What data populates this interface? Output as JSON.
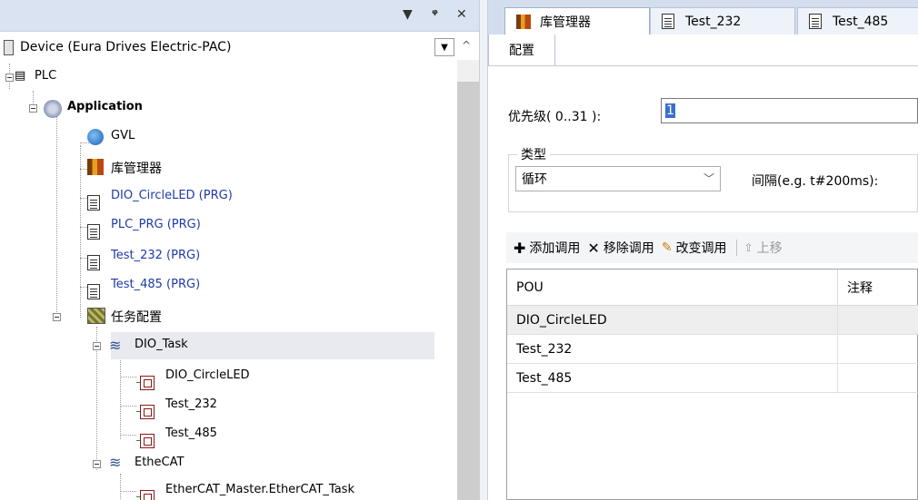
{
  "left_pane": {
    "header_buttons": [
      "▼",
      "ᵠ",
      "✕"
    ],
    "device_title": "Device (Eura Drives Electric-PAC)",
    "tree": [
      {
        "label": "PLC",
        "level": 0,
        "style": "normal"
      },
      {
        "label": "Application",
        "level": 1,
        "style": "bold"
      },
      {
        "label": "GVL",
        "level": 2,
        "style": "normal"
      },
      {
        "label": "库管理器",
        "level": 2,
        "style": "normal"
      },
      {
        "label": "DIO_CircleLED (PRG)",
        "level": 2,
        "style": "blue"
      },
      {
        "label": "PLC_PRG (PRG)",
        "level": 2,
        "style": "blue"
      },
      {
        "label": "Test_232 (PRG)",
        "level": 2,
        "style": "blue"
      },
      {
        "label": "Test_485 (PRG)",
        "level": 2,
        "style": "blue"
      },
      {
        "label": "任务配置",
        "level": 2,
        "style": "normal"
      },
      {
        "label": "DIO_Task",
        "level": 3,
        "style": "normal",
        "selected": true
      },
      {
        "label": "DIO_CircleLED",
        "level": 4,
        "style": "normal"
      },
      {
        "label": "Test_232",
        "level": 4,
        "style": "normal"
      },
      {
        "label": "Test_485",
        "level": 4,
        "style": "normal"
      },
      {
        "label": "EtheCAT",
        "level": 3,
        "style": "normal"
      },
      {
        "label": "EtherCAT_Master.EtherCAT_Task",
        "level": 4,
        "style": "normal"
      }
    ]
  },
  "right_pane": {
    "tabs": [
      {
        "label": "库管理器",
        "icon": "library-manager-icon",
        "active": true
      },
      {
        "label": "Test_232",
        "icon": "document-icon",
        "active": false
      },
      {
        "label": "Test_485",
        "icon": "document-icon",
        "active": false
      }
    ],
    "config_tab_label": "配置",
    "priority_label": "优先级( 0..31 ):",
    "priority_value": "1",
    "type_group_label": "类型",
    "type_value": "循环",
    "interval_label": "间隔(e.g. t#200ms):",
    "toolbar": {
      "add_call": "添加调用",
      "remove_call": "移除调用",
      "change_call": "改变调用",
      "move_up": "上移"
    },
    "table": {
      "columns": [
        "POU",
        "注释"
      ],
      "rows": [
        "DIO_CircleLED",
        "Test_232",
        "Test_485"
      ]
    }
  }
}
